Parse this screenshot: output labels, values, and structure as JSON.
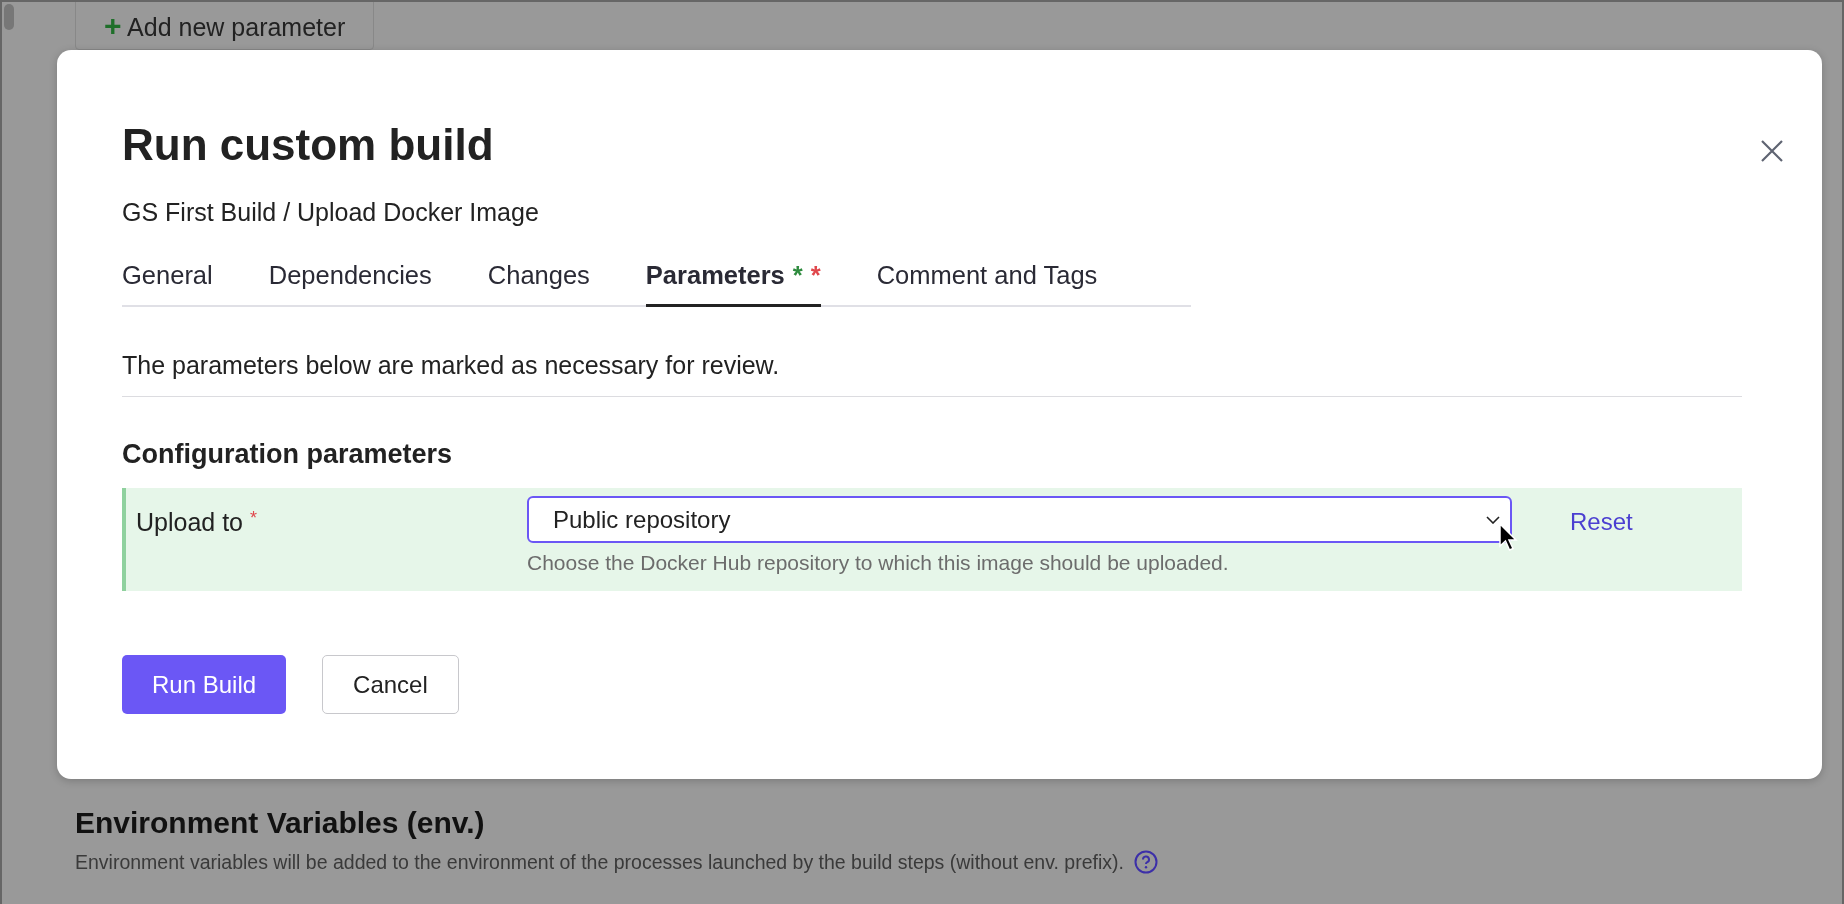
{
  "background": {
    "add_button": {
      "icon": "+",
      "label": "Add new parameter"
    },
    "section_title": "Environment Variables (env.)",
    "section_description": "Environment variables will be added to the environment of the processes launched by the build steps (without env. prefix)."
  },
  "dialog": {
    "title": "Run custom build",
    "subtitle": "GS First Build / Upload Docker Image",
    "tabs": [
      {
        "label": "General",
        "selected": false
      },
      {
        "label": "Dependencies",
        "selected": false
      },
      {
        "label": "Changes",
        "selected": false
      },
      {
        "label": "Parameters",
        "selected": true,
        "marks": [
          {
            "text": "*",
            "color": "#2e8b3e"
          },
          {
            "text": "*",
            "color": "#e0474c"
          }
        ]
      },
      {
        "label": "Comment and Tags",
        "selected": false
      }
    ],
    "notice": "The parameters below are marked as necessary for review.",
    "section_title": "Configuration parameters",
    "parameters": [
      {
        "label": "Upload to",
        "required_mark": "*",
        "value": "Public repository",
        "hint": "Choose the Docker Hub repository to which this image should be uploaded.",
        "reset": "Reset",
        "highlighted": true,
        "focused": true
      }
    ],
    "buttons": [
      {
        "label": "Run Build",
        "kind": "primary"
      },
      {
        "label": "Cancel",
        "kind": "secondary"
      }
    ]
  }
}
